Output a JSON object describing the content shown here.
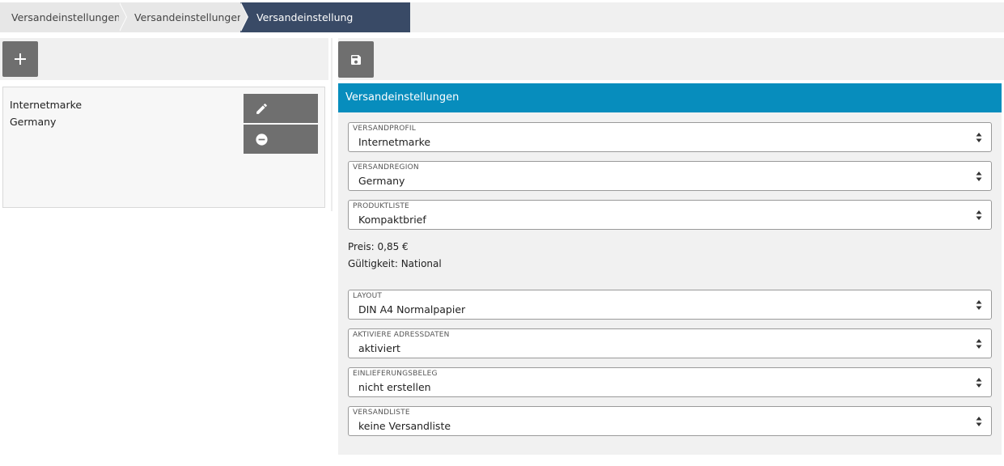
{
  "breadcrumb": {
    "items": [
      "Versandeinstellungen",
      "Versandeinstellungen",
      "Versandeinstellung bearbeiten"
    ]
  },
  "left": {
    "card": {
      "line1": "Internetmarke",
      "line2": "Germany"
    }
  },
  "panel": {
    "title": "Versandeinstellungen",
    "header_color": "#078dbd",
    "fields": [
      {
        "label": "VERSANDPROFIL",
        "value": "Internetmarke"
      },
      {
        "label": "VERSANDREGION",
        "value": "Germany"
      },
      {
        "label": "PRODUKTLISTE",
        "value": "Kompaktbrief"
      },
      {
        "label": "LAYOUT",
        "value": "DIN A4 Normalpapier"
      },
      {
        "label": "AKTIVIERE ADRESSDATEN",
        "value": "aktiviert"
      },
      {
        "label": "EINLIEFERUNGSBELEG",
        "value": "nicht erstellen"
      },
      {
        "label": "VERSANDLISTE",
        "value": "keine Versandliste"
      }
    ],
    "price": "Preis: 0,85 €",
    "validity": "Gültigkeit: National"
  },
  "icons": {
    "add": "plus-icon",
    "save": "floppy-disk-icon",
    "edit": "pencil-icon",
    "remove": "minus-circle-icon",
    "select": "sort-arrows-icon"
  }
}
